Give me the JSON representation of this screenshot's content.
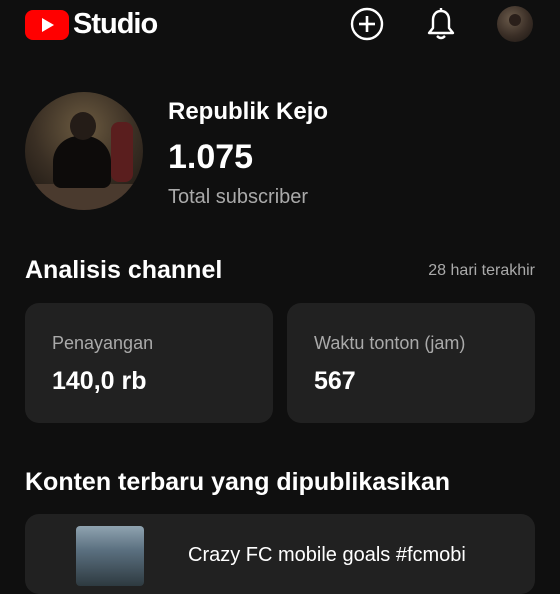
{
  "header": {
    "logo_text": "Studio",
    "icons": [
      "create-icon",
      "bell-icon",
      "account-avatar"
    ]
  },
  "profile": {
    "channel_name": "Republik Kejo",
    "subscriber_count": "1.075",
    "subscriber_label": "Total subscriber"
  },
  "analytics": {
    "title": "Analisis channel",
    "period": "28 hari terakhir",
    "cards": [
      {
        "label": "Penayangan",
        "value": "140,0 rb"
      },
      {
        "label": "Waktu tonton (jam)",
        "value": "567"
      }
    ]
  },
  "latest": {
    "title": "Konten terbaru yang dipublikasikan",
    "video_title": "Crazy FC mobile goals #fcmobi"
  },
  "colors": {
    "background": "#0f0f0f",
    "card": "#212121",
    "brand_red": "#ff0000",
    "secondary_text": "#aaaaaa"
  }
}
